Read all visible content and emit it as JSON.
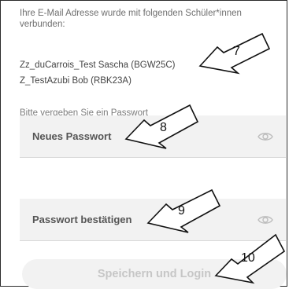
{
  "info": {
    "intro_text": "Ihre E-Mail Adresse wurde mit folgenden Schüler*innen verbunden:",
    "students": [
      "Zz_duCarrois_Test Sascha (BGW25C)",
      "Z_TestAzubi Bob (RBK23A)"
    ],
    "password_prompt": "Bitte vergeben Sie ein Passwort"
  },
  "form": {
    "new_password_label": "Neues Passwort",
    "confirm_password_label": "Passwort bestätigen",
    "save_button_label": "Speichern und Login"
  },
  "annotations": [
    "7",
    "8",
    "9",
    "10"
  ],
  "colors": {
    "field_background": "#f2f2f2",
    "button_background": "#f2f2f2",
    "button_text_disabled": "#c6c6c6",
    "text_gray": "#6f6f6f"
  },
  "icons": {
    "password_visibility": "eye-icon"
  }
}
